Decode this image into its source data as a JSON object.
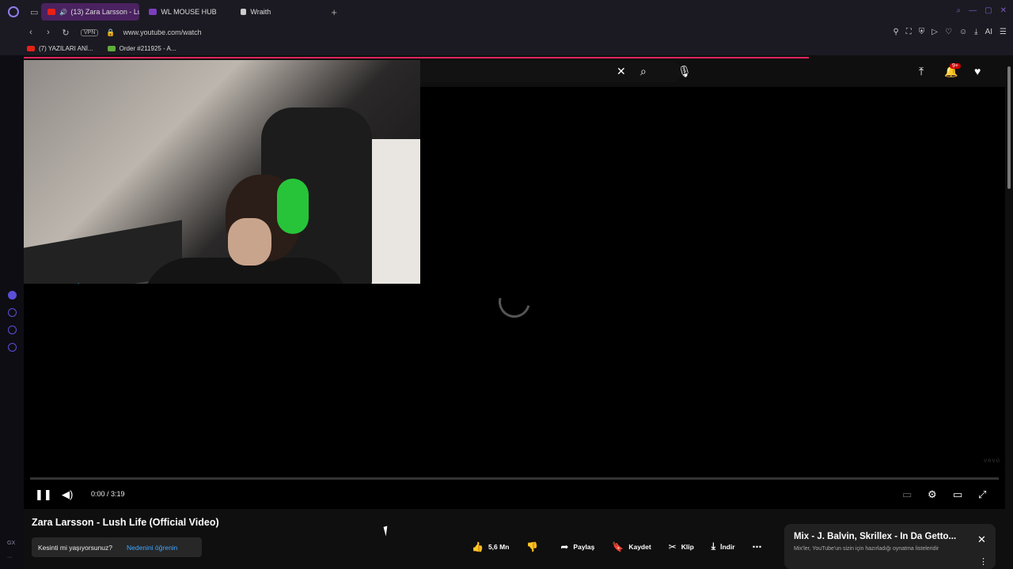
{
  "browser": {
    "tabs": [
      {
        "label": "(13) Zara Larsson - Lus",
        "active": true,
        "favicon_color": "#e62117"
      },
      {
        "label": "WL MOUSE HUB",
        "active": false,
        "favicon_color": "#7b3fbf"
      },
      {
        "label": "Wraith",
        "active": false,
        "favicon_color": "#cccccc"
      }
    ],
    "new_tab_label": "+",
    "url": "www.youtube.com/watch",
    "vpn_label": "VPN",
    "ai_label": "AI",
    "bookmarks": [
      {
        "label": "(7) YAZILARI ANİ...",
        "favicon_color": "#e62117"
      },
      {
        "label": "Order #211925 - A...",
        "favicon_color": "#5fae3b"
      }
    ]
  },
  "youtube": {
    "notification_badge": "9+",
    "player": {
      "time": "0:00 / 3:19",
      "watermark": "vevo",
      "progress_fraction": 0.0
    },
    "video_title": "Zara Larsson - Lush Life (Official Video)",
    "notice": {
      "question": "Kesinti mi yaşıyorsunuz?",
      "link": "Nedenini öğrenin"
    },
    "actions": {
      "likes": "5,6 Mn",
      "share": "Paylaş",
      "save": "Kaydet",
      "clip": "Klip",
      "download": "İndir"
    },
    "mix": {
      "title": "Mix - J. Balvin, Skrillex - In Da Getto...",
      "subtitle": "Mix'ler, YouTube'un sizin için hazırladığı oynatma listeleridir"
    }
  },
  "sidebar": {
    "bottom_text": "GX",
    "more": "···"
  },
  "colors": {
    "accent": "#e0245e",
    "tab_active": "#4a2260",
    "link": "#3ea6ff"
  }
}
